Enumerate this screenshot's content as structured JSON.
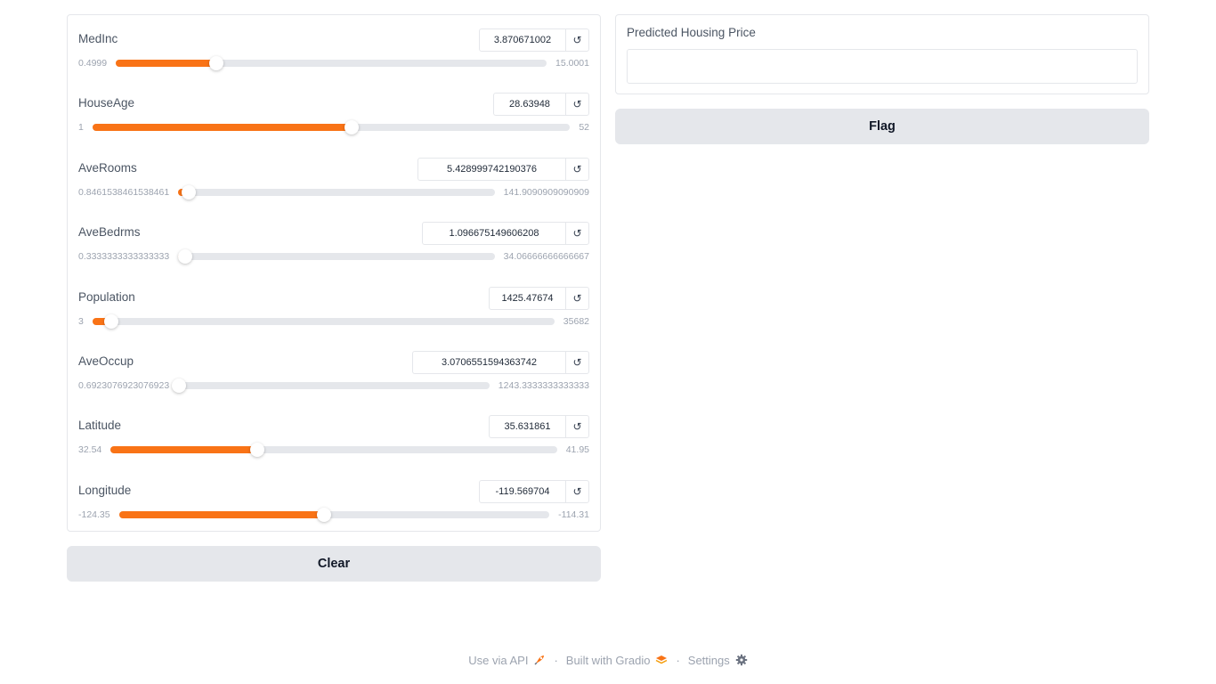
{
  "sliders": [
    {
      "label": "MedInc",
      "value": "3.870671002",
      "min_label": "0.4999",
      "max_label": "15.0001",
      "min": 0.4999,
      "max": 15.0001,
      "current": 3.870671002,
      "box_width": 122
    },
    {
      "label": "HouseAge",
      "value": "28.63948",
      "min_label": "1",
      "max_label": "52",
      "min": 1,
      "max": 52,
      "current": 28.63948,
      "box_width": 106
    },
    {
      "label": "AveRooms",
      "value": "5.428999742190376",
      "min_label": "0.8461538461538461",
      "max_label": "141.9090909090909",
      "min": 0.8461538461538461,
      "max": 141.9090909090909,
      "current": 5.428999742190376,
      "box_width": 191
    },
    {
      "label": "AveBedrms",
      "value": "1.096675149606208",
      "min_label": "0.3333333333333333",
      "max_label": "34.06666666666667",
      "min": 0.3333333333333333,
      "max": 34.06666666666667,
      "current": 1.096675149606208,
      "box_width": 186
    },
    {
      "label": "Population",
      "value": "1425.47674",
      "min_label": "3",
      "max_label": "35682",
      "min": 3,
      "max": 35682,
      "current": 1425.47674,
      "box_width": 111
    },
    {
      "label": "AveOccup",
      "value": "3.0706551594363742",
      "min_label": "0.6923076923076923",
      "max_label": "1243.3333333333333",
      "min": 0.6923076923076923,
      "max": 1243.3333333333333,
      "current": 3.0706551594363742,
      "box_width": 197
    },
    {
      "label": "Latitude",
      "value": "35.631861",
      "min_label": "32.54",
      "max_label": "41.95",
      "min": 32.54,
      "max": 41.95,
      "current": 35.631861,
      "box_width": 111
    },
    {
      "label": "Longitude",
      "value": "-119.569704",
      "min_label": "-124.35",
      "max_label": "-114.31",
      "min": -124.35,
      "max": -114.31,
      "current": -119.569704,
      "box_width": 122
    }
  ],
  "reset_icon": "↺",
  "buttons": {
    "clear": "Clear",
    "flag": "Flag"
  },
  "output": {
    "label": "Predicted Housing Price",
    "value": ""
  },
  "footer": {
    "api": "Use via API",
    "built": "Built with Gradio",
    "settings": "Settings",
    "sep": "·"
  },
  "colors": {
    "accent": "#f97316",
    "track": "#e5e7eb",
    "button_bg": "#e5e7eb"
  }
}
